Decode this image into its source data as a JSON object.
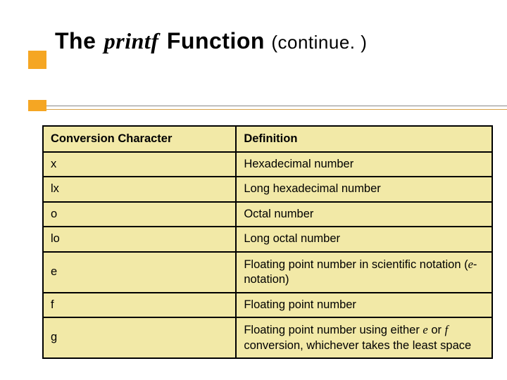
{
  "slide": {
    "title": {
      "the": "The",
      "printf": "printf",
      "fn": "Function",
      "cont": "(continue. )"
    },
    "table": {
      "headers": {
        "col1": "Conversion Character",
        "col2": "Definition"
      },
      "rows": [
        {
          "char": "x",
          "def_parts": [
            {
              "t": "Hexadecimal number"
            }
          ]
        },
        {
          "char": "lx",
          "def_parts": [
            {
              "t": "Long hexadecimal number"
            }
          ]
        },
        {
          "char": "o",
          "def_parts": [
            {
              "t": "Octal number"
            }
          ]
        },
        {
          "char": "lo",
          "def_parts": [
            {
              "t": "Long octal number"
            }
          ]
        },
        {
          "char": "e",
          "def_parts": [
            {
              "t": "Floating point number in scientific notation ("
            },
            {
              "t": "e",
              "ital": true
            },
            {
              "t": "-notation)"
            }
          ]
        },
        {
          "char": "f",
          "def_parts": [
            {
              "t": "Floating point number"
            }
          ]
        },
        {
          "char": "g",
          "def_parts": [
            {
              "t": "Floating point number using either "
            },
            {
              "t": "e",
              "ital": true
            },
            {
              "t": " or "
            },
            {
              "t": "f",
              "ital": true
            },
            {
              "t": " conversion, whichever takes the least space"
            }
          ]
        }
      ]
    }
  },
  "chart_data": {
    "type": "table",
    "title": "The printf Function (continue.)",
    "columns": [
      "Conversion Character",
      "Definition"
    ],
    "rows": [
      [
        "x",
        "Hexadecimal number"
      ],
      [
        "lx",
        "Long hexadecimal number"
      ],
      [
        "o",
        "Octal number"
      ],
      [
        "lo",
        "Long octal number"
      ],
      [
        "e",
        "Floating point number in scientific notation (e-notation)"
      ],
      [
        "f",
        "Floating point number"
      ],
      [
        "g",
        "Floating point number using either e or f conversion, whichever takes the least space"
      ]
    ]
  }
}
